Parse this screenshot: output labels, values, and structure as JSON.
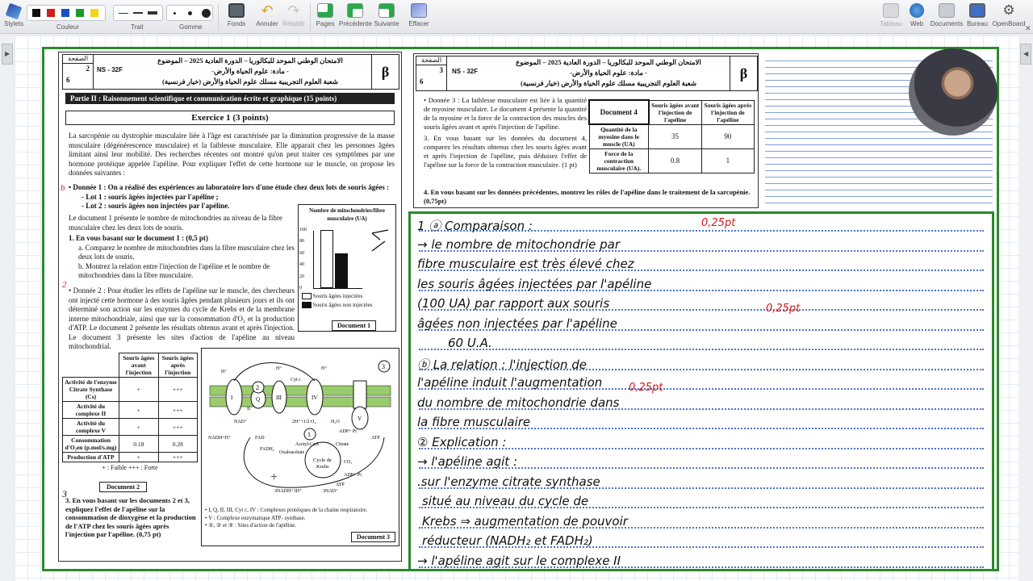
{
  "toolbar": {
    "stylets": "Stylets",
    "couleur": "Couleur",
    "trait": "Trait",
    "gomme": "Gomme",
    "fonds": "Fonds",
    "annuler": "Annuler",
    "retablir": "Rétablir",
    "pages": "Pages",
    "precedente": "Précédente",
    "suivante": "Suivante",
    "effacer": "Effacer",
    "tableau": "Tableau",
    "web": "Web",
    "documents": "Documents",
    "bureau": "Bureau",
    "openboard": "OpenBoard",
    "colors": [
      "#111111",
      "#d01c1c",
      "#1b4fc4",
      "#1a9a2a",
      "#f2d71a"
    ]
  },
  "left_page": {
    "page_label": "الصفحة",
    "page_num": "2",
    "page_total": "6",
    "code": "NS - 32F",
    "beta": "β",
    "hdr_line1": "الامتحان الوطني الموحد للبكالوريا – الدورة العادية 2025 – الموضوع",
    "hdr_line2": "- مادة: علوم الحياة والأرض-",
    "hdr_line3": "شعبة العلوم التجريبية مسلك علوم الحياة والأرض (خيار فرنسية)",
    "part": "Partie II : Raisonnement scientifique et communication écrite et graphique (15 points)",
    "exercise": "Exercice 1 (3 points)",
    "intro": "La sarcopénie ou dystrophie musculaire liée à l'âge est caractérisée par la diminution progressive de la masse musculaire (dégénérescence musculaire) et la faiblesse musculaire. Elle apparait chez les personnes âgées limitant ainsi leur mobilité. Des recherches récentes ont montré qu'on peut traiter ces symptômes par une hormone protéique appelée l'apéline. Pour expliquer l'effet de cette hormone sur le muscle, on propose les données suivantes :",
    "d1": "• Donnée 1 : On a réalisé des expériences au laboratoire lors d'une étude chez deux lots de souris âgées :",
    "lot1": "- Lot 1 : souris âgées injectées par l'apéline ;",
    "lot2": "- Lot 2 : souris âgées non injectées par l'apéline.",
    "d1b": "Le document 1 présente le nombre de mitochondries au niveau de la fibre musculaire chez les deux lots de souris.",
    "q1": "1. En vous basant sur le document 1 : (0,5 pt)",
    "q1a": "a. Comparez le nombre de mitochondries dans la fibre musculaire chez les deux lots de souris.",
    "q1b": "b. Montrez la relation entre l'injection de l'apéline et le nombre de mitochondries dans la fibre musculaire.",
    "d2": "• Donnée 2 : Pour étudier les effets de l'apéline sur le muscle, des chercheurs ont injecté cette hormone à des souris âgées pendant plusieurs jours et ils ont déterminé son action sur les enzymes du cycle de Krebs et de la membrane interne mitochondriale, ainsi que sur la consommation d'O₂ et la production d'ATP. Le document 2 présente les résultats obtenus avant et après l'injection. Le document 3 présente les sites d'action de l'apéline au niveau mitochondrial.",
    "doc1_title": "Nombre de mitochondries/fibre musculaire (UA)",
    "doc1_ticks": [
      "100",
      "80",
      "60",
      "40",
      "20",
      "0"
    ],
    "doc1_legend1": "Souris âgées injectées",
    "doc1_legend2": "Souris âgées non injectées",
    "doc1_label": "Document 1",
    "doc2_head": [
      "",
      "Souris âgées avant l'injection",
      "Souris âgées après l'injection"
    ],
    "doc2_rows": [
      [
        "Activité de l'enzyme Citrate Synthase (Cs)",
        "+",
        "+++"
      ],
      [
        "Activité du complexe II",
        "+",
        "+++"
      ],
      [
        "Activité du complexe V",
        "+",
        "+++"
      ],
      [
        "Consommation d'O₂en (p.mol/s.mg)",
        "0.18",
        "0.28"
      ],
      [
        "Production d'ATP",
        "+",
        "+++"
      ]
    ],
    "doc2_key": "+ : Faible        +++ : Forte",
    "doc2_label": "Document 2",
    "q3": "3. En vous basant sur les documents 2 et 3, expliquez l'effet de l'apéline sur la consommation de dioxygène et la production de l'ATP chez les souris âgées après l'injection par l'apéline. (0,75 pt)",
    "doc3_key1": "• I, Q, II, III, Cyt c, IV : Complexes protéiques de la chaine respiratoire.",
    "doc3_key2": "• V : Complexe enzymatique ATP- synthase.",
    "doc3_key3": "• ①, ② et ③ : Sites d'action de l'apéline.",
    "doc3_label": "Document 3",
    "doc3_items": [
      "NAD⁺",
      "NADH+H⁺",
      "FAD",
      "FADH₂",
      "Acétyl-CoA",
      "Oxaloacétate",
      "Citrate",
      "Cycle de Krebs",
      "CO₂",
      "ADP+ Pi",
      "ATP",
      "3NADH+3H⁺",
      "3NAD⁺",
      "2H⁺+1/2 O₂",
      "H₂O",
      "H⁺",
      "Cyt c",
      "Q",
      "I",
      "II",
      "III",
      "IV",
      "V"
    ]
  },
  "right_page": {
    "page_label": "الصفحة",
    "page_num": "3",
    "page_total": "6",
    "code": "NS - 32F",
    "beta": "β",
    "hdr_line1": "الامتحان الوطني الموحد للبكالوريا – الدورة العادية 2025 – الموضوع",
    "hdr_line2": "- مادة: علوم الحياة والأرض-",
    "hdr_line3": "شعبة العلوم التجريبية مسلك علوم الحياة والأرض (خيار فرنسية)",
    "d3": "• Donnée 3 : La faiblesse musculaire est liée à la quantité de myosine musculaire. Le document 4 présente la quantité de la myosine et la force de la contraction des muscles des souris âgées avant et après l'injection de l'apéline.",
    "q3": "3. En vous basant sur les données du document 4, comparez les résultats obtenus chez les souris âgées avant et après l'injection de l'apéline, puis déduisez l'effet de l'apéline sur la force de la contraction musculaire. (1 pt)",
    "q4": "4. En vous basant sur les données précédentes, montrez les rôles de l'apéline dans le traitement de la sarcopénie. (0,75pt)",
    "doc4_title": "Document 4",
    "doc4_head": [
      "Souris âgées avant l'injection de l'apéline",
      "Souris âgées après l'injection de l'apéline"
    ],
    "doc4_rows": [
      [
        "Quantité de la myosine dans le muscle (UA)",
        "35",
        "90"
      ],
      [
        "Force de la contraction musculaire (UA).",
        "0.8",
        "1"
      ]
    ]
  },
  "handwriting": {
    "lines": [
      "1 ⓐ Comparaison :",
      "→ le nombre de mitochondrie par",
      "fibre musculaire est très élevé chez",
      "les souris âgées injectées par l'apéline",
      "(100 UA) par rapport aux souris",
      "âgées non injectées par l'apéline",
      "60 U.A.",
      "ⓑ La relation : l'injection de",
      "l'apéline induit l'augmentation",
      "du nombre de mitochondrie dans",
      "la fibre musculaire",
      "② Explication :",
      "→ l'apéline agit :",
      ".sur l'enzyme citrate synthase",
      "situé au niveau du cycle de",
      "Krebs ⇒ augmentation de pouvoir",
      "réducteur (NADH₂ et FADH₂)",
      "→ l'apéline agit sur le complexe II"
    ],
    "marks": [
      "0,25pt",
      "0,25pt",
      "0,25pt"
    ]
  },
  "chart_doc1": {
    "type": "bar",
    "categories": [
      "Souris âgées injectées",
      "Souris âgées non injectées"
    ],
    "values": [
      100,
      60
    ],
    "ylim": [
      0,
      100
    ]
  }
}
